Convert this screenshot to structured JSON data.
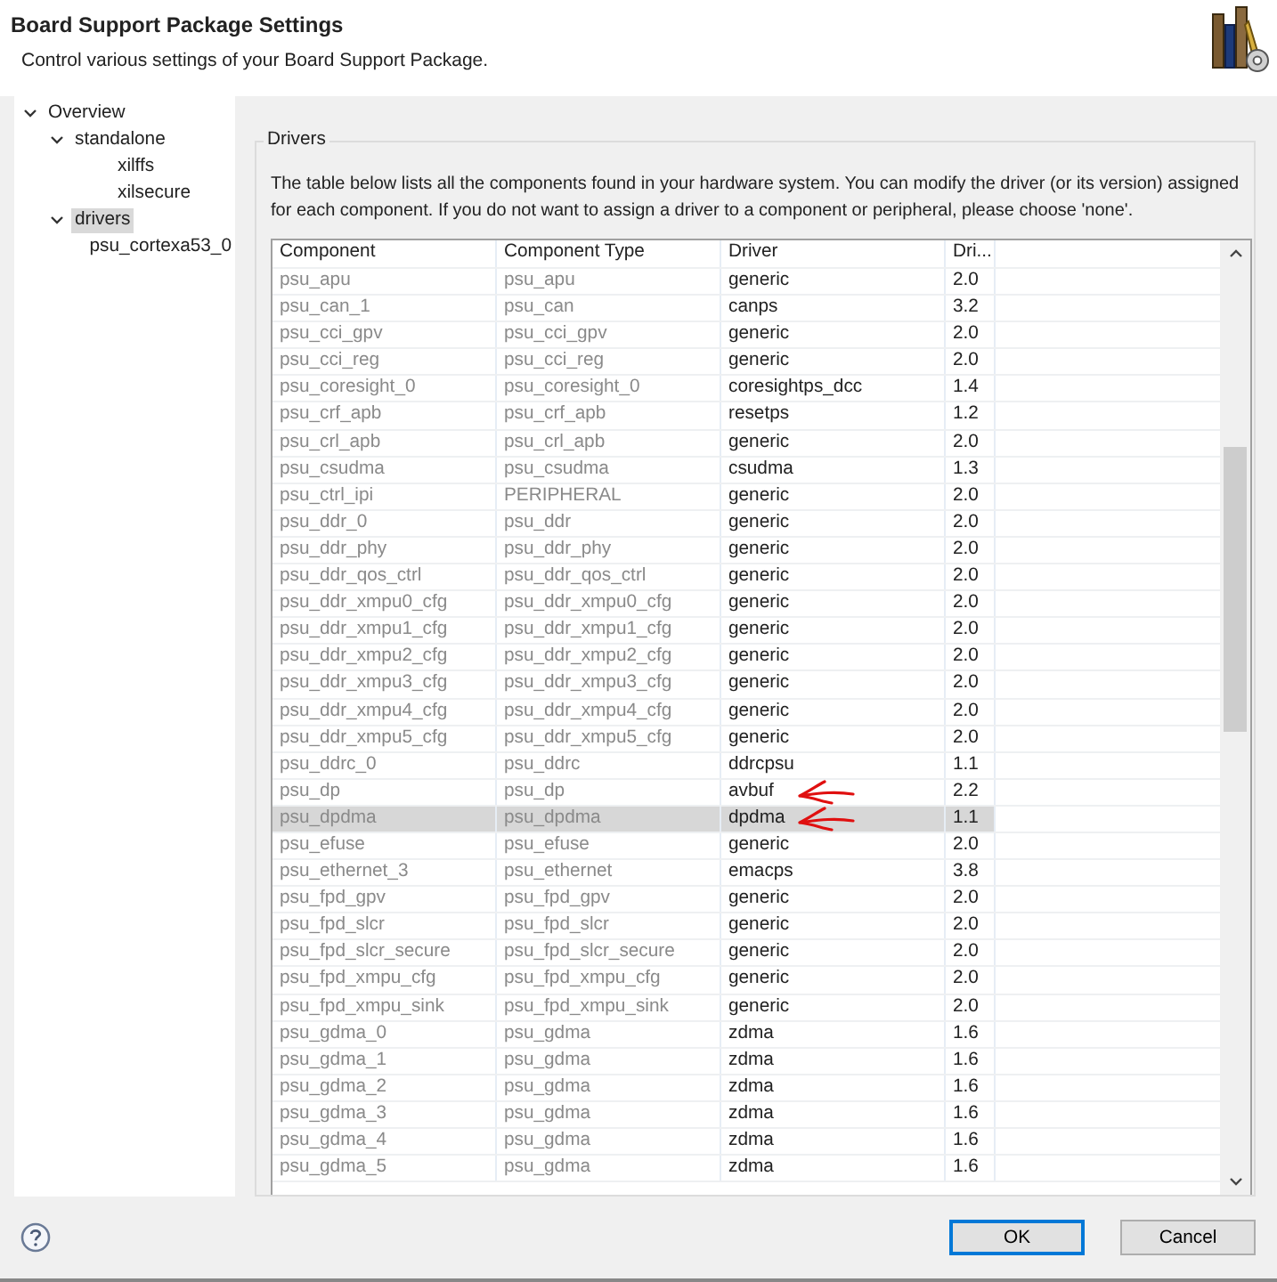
{
  "header": {
    "title": "Board Support Package Settings",
    "subtitle": "Control various settings of your Board Support Package."
  },
  "tree": [
    {
      "label": "Overview",
      "expanded": true,
      "selected": false,
      "children": [
        {
          "label": "standalone",
          "expanded": true,
          "selected": false,
          "children": [
            {
              "label": "xilffs",
              "selected": false
            },
            {
              "label": "xilsecure",
              "selected": false
            }
          ]
        },
        {
          "label": "drivers",
          "expanded": true,
          "selected": true,
          "children": [
            {
              "label": "psu_cortexa53_0",
              "selected": false
            }
          ]
        }
      ]
    }
  ],
  "drivers": {
    "group_title": "Drivers",
    "description": "The table below lists all the components found in your hardware system. You can modify the driver (or its version) assigned for each component. If you do not want to assign a driver to a component or peripheral, please choose 'none'.",
    "columns": [
      "Component",
      "Component Type",
      "Driver",
      "Dri..."
    ],
    "rows": [
      {
        "component": "psu_apu",
        "type": "psu_apu",
        "driver": "generic",
        "version": "2.0",
        "selected": false,
        "marked": false
      },
      {
        "component": "psu_can_1",
        "type": "psu_can",
        "driver": "canps",
        "version": "3.2",
        "selected": false,
        "marked": false
      },
      {
        "component": "psu_cci_gpv",
        "type": "psu_cci_gpv",
        "driver": "generic",
        "version": "2.0",
        "selected": false,
        "marked": false
      },
      {
        "component": "psu_cci_reg",
        "type": "psu_cci_reg",
        "driver": "generic",
        "version": "2.0",
        "selected": false,
        "marked": false
      },
      {
        "component": "psu_coresight_0",
        "type": "psu_coresight_0",
        "driver": "coresightps_dcc",
        "version": "1.4",
        "selected": false,
        "marked": false
      },
      {
        "component": "psu_crf_apb",
        "type": "psu_crf_apb",
        "driver": "resetps",
        "version": "1.2",
        "selected": false,
        "marked": false
      },
      {
        "component": "psu_crl_apb",
        "type": "psu_crl_apb",
        "driver": "generic",
        "version": "2.0",
        "selected": false,
        "marked": false
      },
      {
        "component": "psu_csudma",
        "type": "psu_csudma",
        "driver": "csudma",
        "version": "1.3",
        "selected": false,
        "marked": false
      },
      {
        "component": "psu_ctrl_ipi",
        "type": "PERIPHERAL",
        "driver": "generic",
        "version": "2.0",
        "selected": false,
        "marked": false
      },
      {
        "component": "psu_ddr_0",
        "type": "psu_ddr",
        "driver": "generic",
        "version": "2.0",
        "selected": false,
        "marked": false
      },
      {
        "component": "psu_ddr_phy",
        "type": "psu_ddr_phy",
        "driver": "generic",
        "version": "2.0",
        "selected": false,
        "marked": false
      },
      {
        "component": "psu_ddr_qos_ctrl",
        "type": "psu_ddr_qos_ctrl",
        "driver": "generic",
        "version": "2.0",
        "selected": false,
        "marked": false
      },
      {
        "component": "psu_ddr_xmpu0_cfg",
        "type": "psu_ddr_xmpu0_cfg",
        "driver": "generic",
        "version": "2.0",
        "selected": false,
        "marked": false
      },
      {
        "component": "psu_ddr_xmpu1_cfg",
        "type": "psu_ddr_xmpu1_cfg",
        "driver": "generic",
        "version": "2.0",
        "selected": false,
        "marked": false
      },
      {
        "component": "psu_ddr_xmpu2_cfg",
        "type": "psu_ddr_xmpu2_cfg",
        "driver": "generic",
        "version": "2.0",
        "selected": false,
        "marked": false
      },
      {
        "component": "psu_ddr_xmpu3_cfg",
        "type": "psu_ddr_xmpu3_cfg",
        "driver": "generic",
        "version": "2.0",
        "selected": false,
        "marked": false
      },
      {
        "component": "psu_ddr_xmpu4_cfg",
        "type": "psu_ddr_xmpu4_cfg",
        "driver": "generic",
        "version": "2.0",
        "selected": false,
        "marked": false
      },
      {
        "component": "psu_ddr_xmpu5_cfg",
        "type": "psu_ddr_xmpu5_cfg",
        "driver": "generic",
        "version": "2.0",
        "selected": false,
        "marked": false
      },
      {
        "component": "psu_ddrc_0",
        "type": "psu_ddrc",
        "driver": "ddrcpsu",
        "version": "1.1",
        "selected": false,
        "marked": false
      },
      {
        "component": "psu_dp",
        "type": "psu_dp",
        "driver": "avbuf",
        "version": "2.2",
        "selected": false,
        "marked": true
      },
      {
        "component": "psu_dpdma",
        "type": "psu_dpdma",
        "driver": "dpdma",
        "version": "1.1",
        "selected": true,
        "marked": true
      },
      {
        "component": "psu_efuse",
        "type": "psu_efuse",
        "driver": "generic",
        "version": "2.0",
        "selected": false,
        "marked": false
      },
      {
        "component": "psu_ethernet_3",
        "type": "psu_ethernet",
        "driver": "emacps",
        "version": "3.8",
        "selected": false,
        "marked": false
      },
      {
        "component": "psu_fpd_gpv",
        "type": "psu_fpd_gpv",
        "driver": "generic",
        "version": "2.0",
        "selected": false,
        "marked": false
      },
      {
        "component": "psu_fpd_slcr",
        "type": "psu_fpd_slcr",
        "driver": "generic",
        "version": "2.0",
        "selected": false,
        "marked": false
      },
      {
        "component": "psu_fpd_slcr_secure",
        "type": "psu_fpd_slcr_secure",
        "driver": "generic",
        "version": "2.0",
        "selected": false,
        "marked": false
      },
      {
        "component": "psu_fpd_xmpu_cfg",
        "type": "psu_fpd_xmpu_cfg",
        "driver": "generic",
        "version": "2.0",
        "selected": false,
        "marked": false
      },
      {
        "component": "psu_fpd_xmpu_sink",
        "type": "psu_fpd_xmpu_sink",
        "driver": "generic",
        "version": "2.0",
        "selected": false,
        "marked": false
      },
      {
        "component": "psu_gdma_0",
        "type": "psu_gdma",
        "driver": "zdma",
        "version": "1.6",
        "selected": false,
        "marked": false
      },
      {
        "component": "psu_gdma_1",
        "type": "psu_gdma",
        "driver": "zdma",
        "version": "1.6",
        "selected": false,
        "marked": false
      },
      {
        "component": "psu_gdma_2",
        "type": "psu_gdma",
        "driver": "zdma",
        "version": "1.6",
        "selected": false,
        "marked": false
      },
      {
        "component": "psu_gdma_3",
        "type": "psu_gdma",
        "driver": "zdma",
        "version": "1.6",
        "selected": false,
        "marked": false
      },
      {
        "component": "psu_gdma_4",
        "type": "psu_gdma",
        "driver": "zdma",
        "version": "1.6",
        "selected": false,
        "marked": false
      },
      {
        "component": "psu_gdma_5",
        "type": "psu_gdma",
        "driver": "zdma",
        "version": "1.6",
        "selected": false,
        "marked": false
      }
    ]
  },
  "buttons": [
    {
      "label": "OK",
      "default": true
    },
    {
      "label": "Cancel",
      "default": false
    }
  ]
}
